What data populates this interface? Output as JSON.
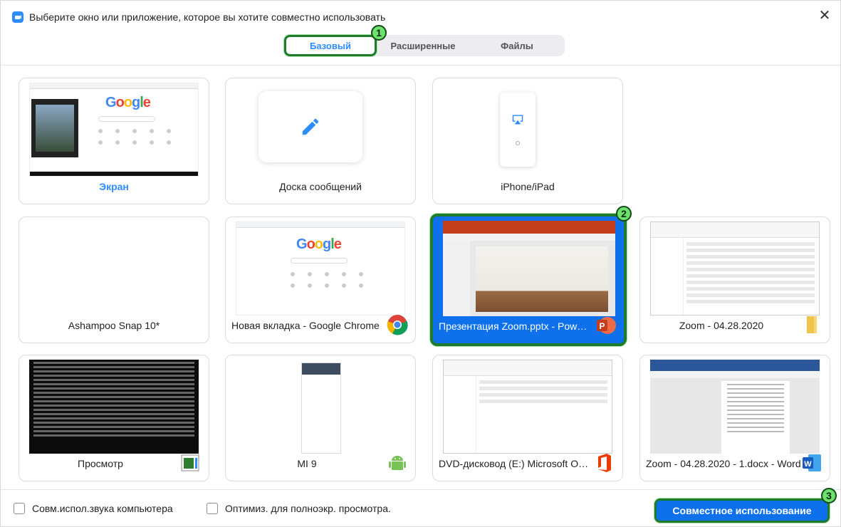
{
  "window": {
    "title": "Выберите окно или приложение, которое вы хотите совместно использовать",
    "close_glyph": "✕"
  },
  "tabs": [
    {
      "label": "Базовый",
      "active": true
    },
    {
      "label": "Расширенные",
      "active": false
    },
    {
      "label": "Файлы",
      "active": false
    }
  ],
  "step_badges": [
    "1",
    "2",
    "3"
  ],
  "cards": [
    {
      "label": "Экран",
      "icon": "screen-thumbnail"
    },
    {
      "label": "Доска сообщений",
      "icon": "pen-icon"
    },
    {
      "label": "iPhone/iPad",
      "icon": "airplay-icon"
    },
    {
      "label": "Ashampoo Snap 10*",
      "icon": ""
    },
    {
      "label": "Новая вкладка - Google Chrome",
      "icon": "chrome-icon"
    },
    {
      "label": "Презентация Zoom.pptx - Power...",
      "icon": "powerpoint-icon",
      "selected": true
    },
    {
      "label": "Zoom - 04.28.2020",
      "icon": "folder-icon"
    },
    {
      "label": "Просмотр",
      "icon": "preview-icon"
    },
    {
      "label": "MI 9",
      "icon": "android-icon"
    },
    {
      "label": "DVD-дисковод (E:) Microsoft Offi...",
      "icon": "office-icon"
    },
    {
      "label": "Zoom - 04.28.2020 - 1.docx - Word",
      "icon": "word-icon"
    }
  ],
  "footer": {
    "share_sound_label": "Совм.испол.звука компьютера",
    "optimize_label": "Оптимиз. для полноэкр. просмотра.",
    "share_button_label": "Совместное использование"
  },
  "colors": {
    "accent": "#2d8cff",
    "selected_bg": "#0e71eb",
    "highlight_border": "#1f7a2e",
    "badge_fill": "#6ee06e"
  }
}
